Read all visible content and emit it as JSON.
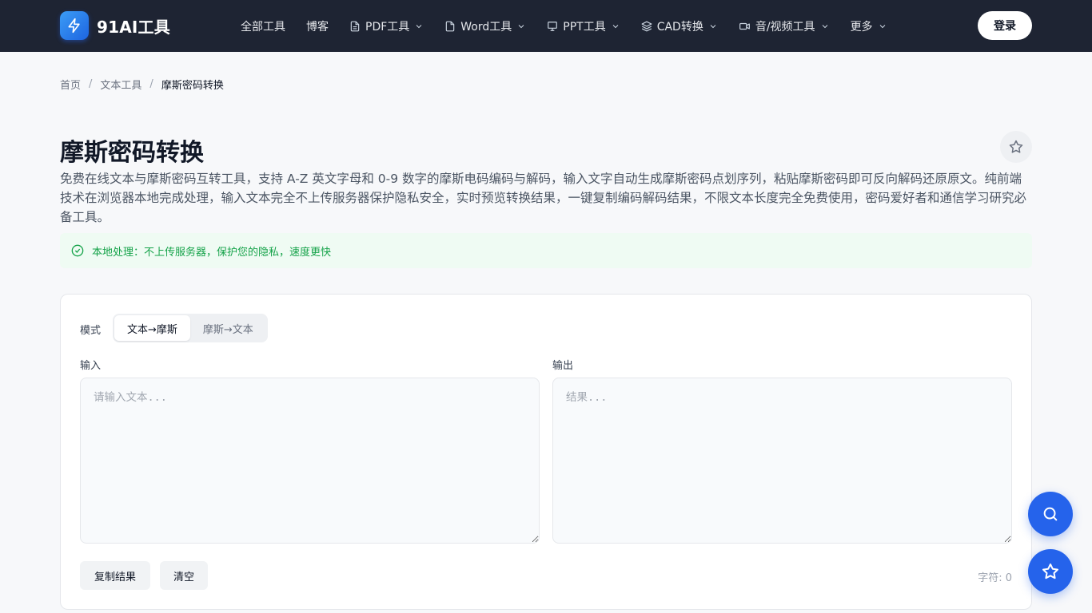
{
  "brand": {
    "name": "91AI工具",
    "color": "#2563eb"
  },
  "nav": {
    "items": [
      {
        "label": "全部工具",
        "icon": "",
        "dropdown": false
      },
      {
        "label": "博客",
        "icon": "",
        "dropdown": false
      },
      {
        "label": "PDF工具",
        "icon": "file-icon",
        "dropdown": true
      },
      {
        "label": "Word工具",
        "icon": "document-icon",
        "dropdown": true
      },
      {
        "label": "PPT工具",
        "icon": "presentation-icon",
        "dropdown": true
      },
      {
        "label": "CAD转换",
        "icon": "layers-icon",
        "dropdown": true
      },
      {
        "label": "音/视频工具",
        "icon": "video-icon",
        "dropdown": true
      },
      {
        "label": "更多",
        "icon": "",
        "dropdown": true
      }
    ],
    "login_label": "登录"
  },
  "breadcrumb": {
    "home": "首页",
    "category": "文本工具",
    "current": "摩斯密码转换",
    "separator": "/"
  },
  "page": {
    "title": "摩斯密码转换",
    "description": "免费在线文本与摩斯密码互转工具，支持 A-Z 英文字母和 0-9 数字的摩斯电码编码与解码，输入文字自动生成摩斯密码点划序列，粘贴摩斯密码即可反向解码还原原文。纯前端技术在浏览器本地完成处理，输入文本完全不上传服务器保护隐私安全，实时预览转换结果，一键复制编码解码结果，不限文本长度完全免费使用，密码爱好者和通信学习研究必备工具。",
    "notice": "本地处理：不上传服务器，保护您的隐私，速度更快"
  },
  "tool": {
    "mode_label": "模式",
    "modes": [
      "文本→摩斯",
      "摩斯→文本"
    ],
    "active_mode": "文本→摩斯",
    "input_label": "输入",
    "input_placeholder": "请输入文本...",
    "input_value": "",
    "output_label": "输出",
    "output_placeholder": "结果...",
    "output_value": "",
    "copy_label": "复制结果",
    "clear_label": "清空",
    "char_count": "字符: 0"
  },
  "colors": {
    "header_bg": "#1e2433",
    "accent": "#2563eb",
    "success": "#16a34a",
    "notice_bg": "#effbf3"
  }
}
